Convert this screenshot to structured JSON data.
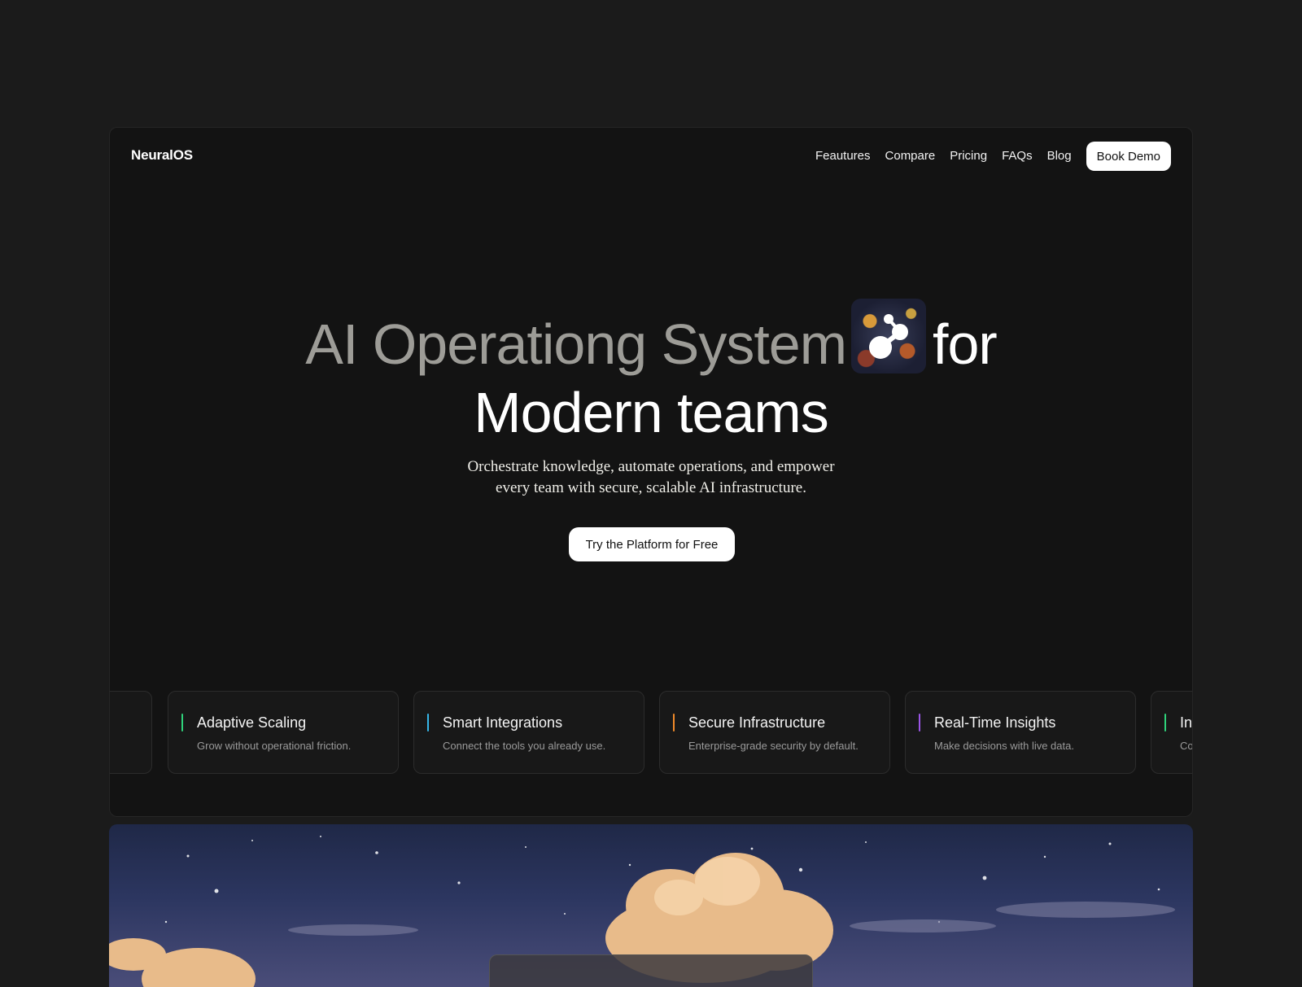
{
  "brand": {
    "name": "NeuralOS"
  },
  "nav": {
    "links": [
      "Feautures",
      "Compare",
      "Pricing",
      "FAQs",
      "Blog"
    ],
    "cta_label": "Book Demo"
  },
  "hero": {
    "title_dim": "AI Operationg System",
    "title_for": "for",
    "title_line2": "Modern teams",
    "subtitle_line1": "Orchestrate knowledge, automate operations, and empower",
    "subtitle_line2": "every team with secure, scalable AI infrastructure.",
    "cta_label": "Try the Platform for Free",
    "thumbnail_icon": "molecule-icon"
  },
  "features": [
    {
      "title": "",
      "desc": "",
      "accent": "#2fd27a"
    },
    {
      "title": "Adaptive Scaling",
      "desc": "Grow without operational friction.",
      "accent": "#2fd27a"
    },
    {
      "title": "Smart Integrations",
      "desc": "Connect the tools you already use.",
      "accent": "#35b6e8"
    },
    {
      "title": "Secure Infrastructure",
      "desc": "Enterprise-grade security by default.",
      "accent": "#f08a2a"
    },
    {
      "title": "Real-Time Insights",
      "desc": "Make decisions with live data.",
      "accent": "#9b55e6"
    },
    {
      "title": "Int",
      "desc": "Co",
      "accent": "#2fd27a"
    }
  ],
  "colors": {
    "page_bg": "#1b1b1b",
    "frame_bg": "#131313",
    "title_dim": "#9d9c97",
    "button_bg": "#ffffff"
  }
}
